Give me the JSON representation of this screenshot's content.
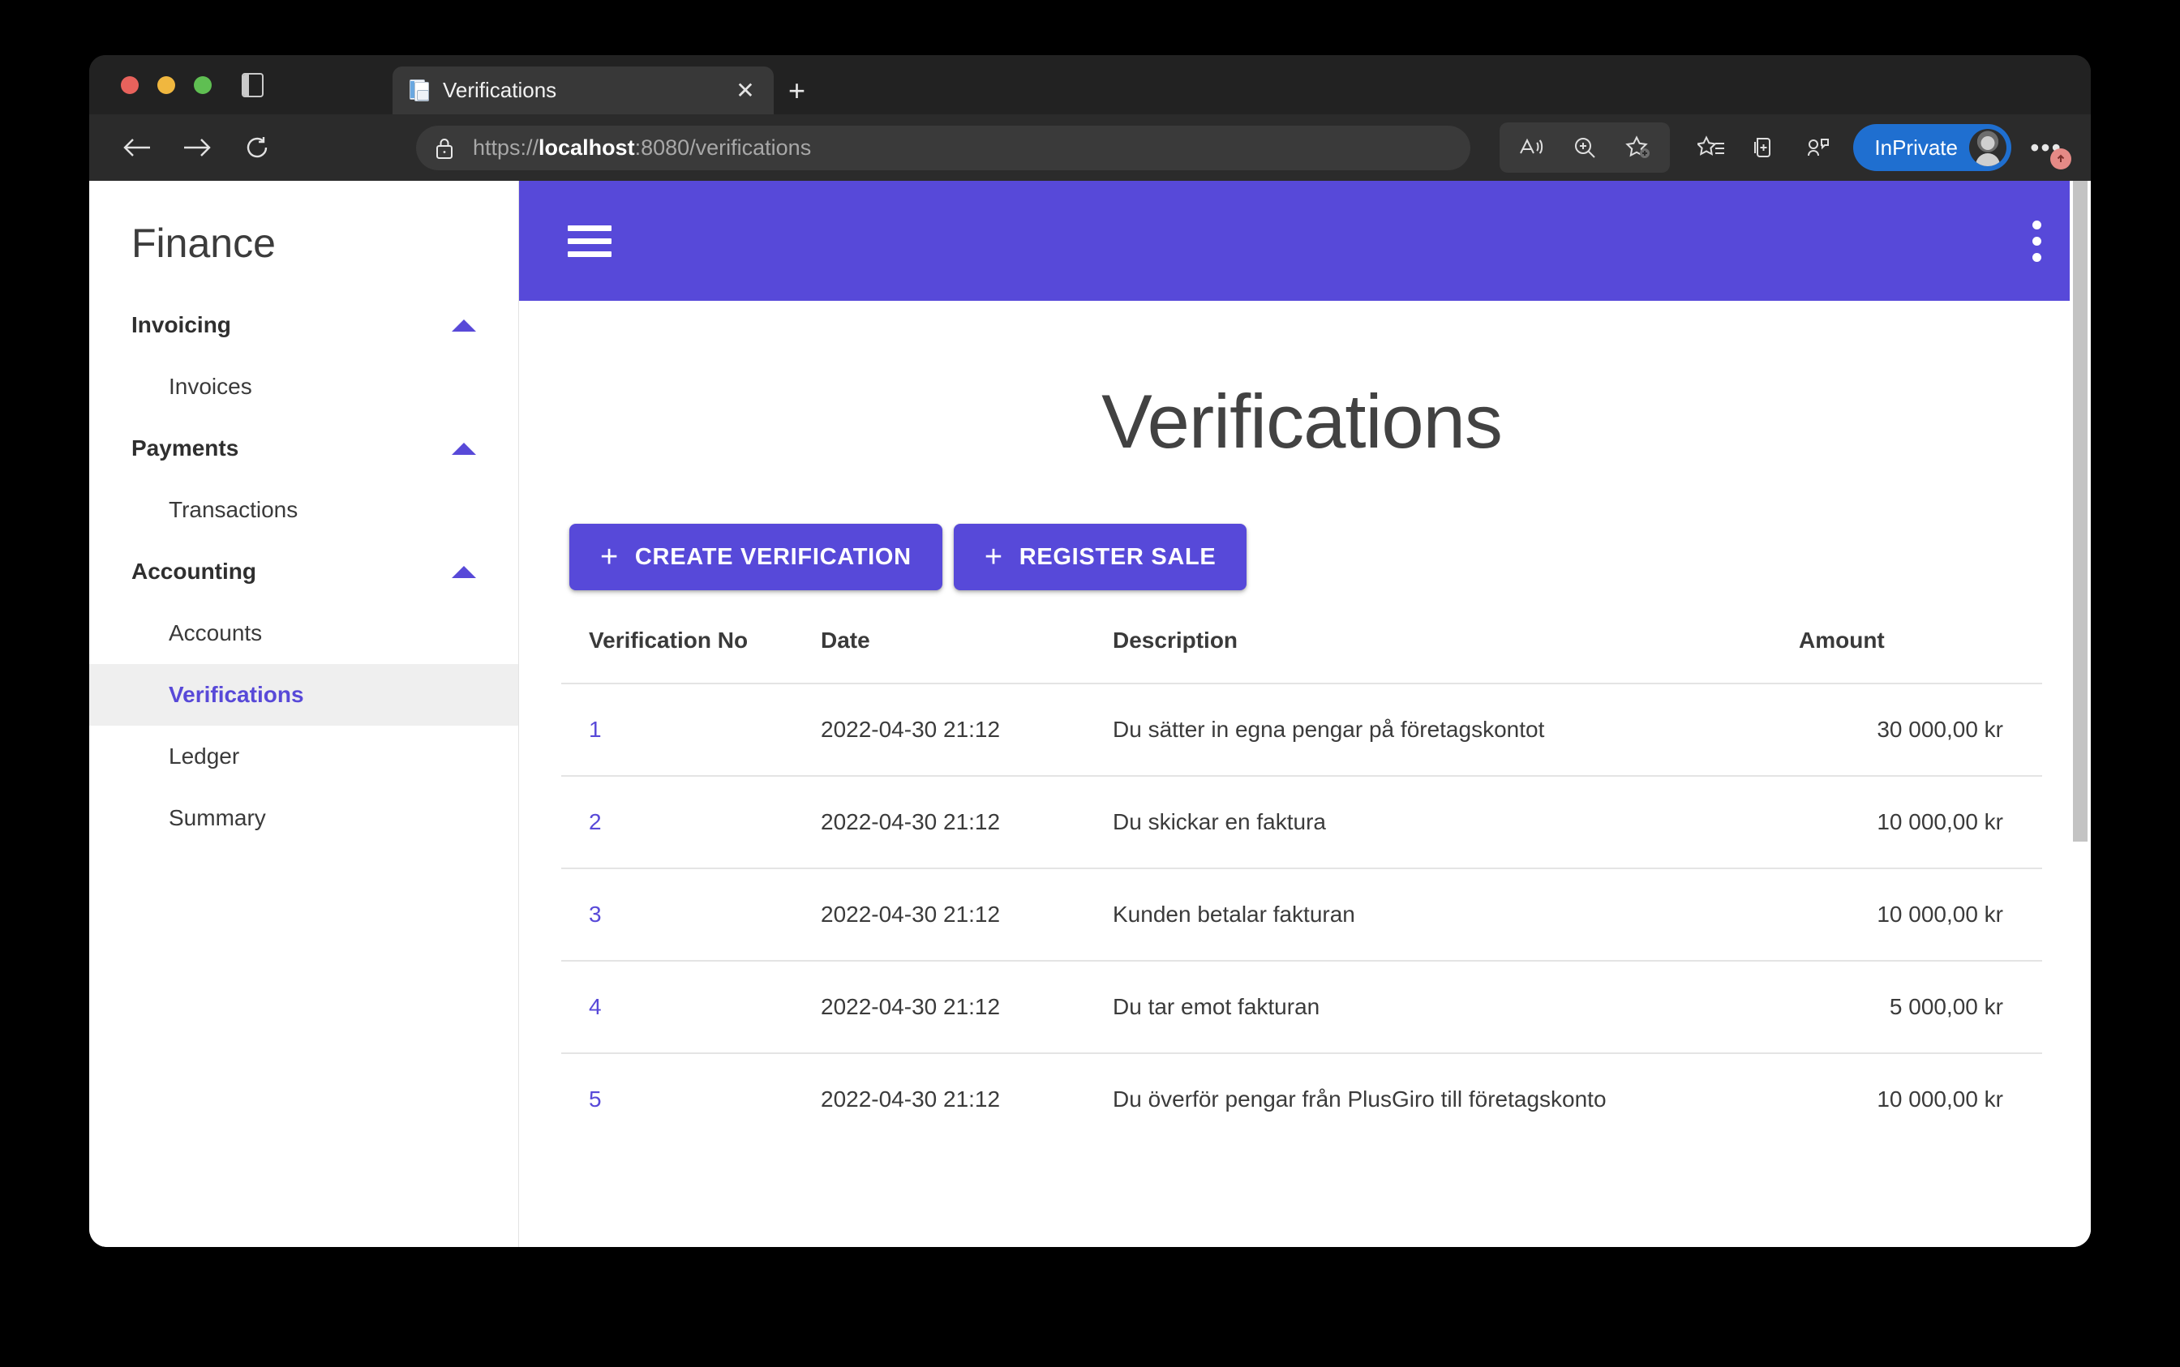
{
  "browser": {
    "traffic_lights": [
      "close",
      "minimize",
      "maximize"
    ],
    "sidebar_toggle_icon": "sidebar-toggle-icon",
    "tab": {
      "title": "Verifications",
      "favicon": "document-pages-icon",
      "close_label": "✕"
    },
    "new_tab_label": "+",
    "nav": {
      "back_icon": "arrow-left-icon",
      "forward_icon": "arrow-right-icon",
      "reload_icon": "reload-icon"
    },
    "address_bar": {
      "lock_icon": "lock-icon",
      "url_prefix": "https://",
      "url_host": "localhost",
      "url_suffix": ":8080/verifications",
      "full_url": "https://localhost:8080/verifications"
    },
    "toolbar_icons": [
      "read-aloud-icon",
      "zoom-icon",
      "add-favorite-icon",
      "favorites-icon",
      "collections-icon",
      "browser-essentials-icon"
    ],
    "inprivate": {
      "label": "InPrivate",
      "avatar_icon": "avatar",
      "badge_color": "#1f6fd0"
    },
    "settings_more": {
      "label": "•••",
      "badge_icon": "update-arrow-icon",
      "badge_color": "#e58a86"
    }
  },
  "sidebar": {
    "brand": "Finance",
    "groups": [
      {
        "label": "Invoicing",
        "caret_icon": "chevron-up-icon",
        "items": [
          {
            "label": "Invoices",
            "active": false
          }
        ]
      },
      {
        "label": "Payments",
        "caret_icon": "chevron-up-icon",
        "items": [
          {
            "label": "Transactions",
            "active": false
          }
        ]
      },
      {
        "label": "Accounting",
        "caret_icon": "chevron-up-icon",
        "items": [
          {
            "label": "Accounts",
            "active": false
          },
          {
            "label": "Verifications",
            "active": true
          },
          {
            "label": "Ledger",
            "active": false
          },
          {
            "label": "Summary",
            "active": false
          }
        ]
      }
    ]
  },
  "appbar": {
    "menu_icon": "hamburger-menu-icon",
    "overflow_icon": "kebab-menu-icon",
    "background": "#5749d9"
  },
  "main": {
    "page_title": "Verifications",
    "actions": [
      {
        "label": "CREATE VERIFICATION",
        "icon": "plus-icon"
      },
      {
        "label": "REGISTER SALE",
        "icon": "plus-icon"
      }
    ],
    "table": {
      "headers": [
        "Verification No",
        "Date",
        "Description",
        "Amount"
      ],
      "rows": [
        {
          "no": "1",
          "date": "2022-04-30 21:12",
          "description": "Du sätter in egna pengar på företagskontot",
          "amount": "30 000,00 kr"
        },
        {
          "no": "2",
          "date": "2022-04-30 21:12",
          "description": "Du skickar en faktura",
          "amount": "10 000,00 kr"
        },
        {
          "no": "3",
          "date": "2022-04-30 21:12",
          "description": "Kunden betalar fakturan",
          "amount": "10 000,00 kr"
        },
        {
          "no": "4",
          "date": "2022-04-30 21:12",
          "description": "Du tar emot fakturan",
          "amount": "5 000,00 kr"
        },
        {
          "no": "5",
          "date": "2022-04-30 21:12",
          "description": "Du överför pengar från PlusGiro till företagskonto",
          "amount": "10 000,00 kr"
        }
      ]
    }
  },
  "colors": {
    "accent": "#5749d9",
    "link": "#5849d8",
    "active_nav_bg": "#efefef",
    "scrollbar": "#c3c3c3"
  }
}
